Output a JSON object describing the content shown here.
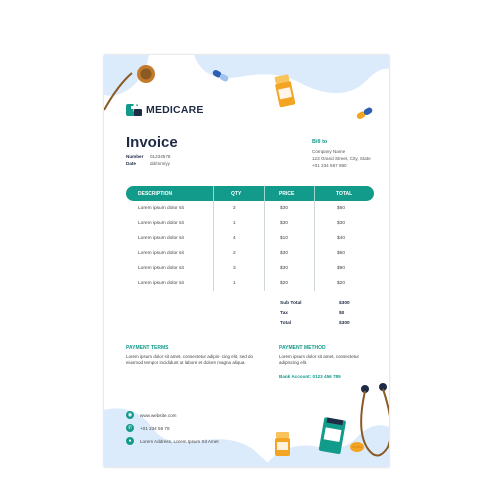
{
  "brand": {
    "name": "MEDICARE"
  },
  "invoice": {
    "title": "Invoice",
    "number_label": "Number",
    "number_value": "01234578",
    "date_label": "Date",
    "date_value": "dd/mm/yy"
  },
  "bill_to": {
    "heading": "Bill to",
    "company": "Company Name",
    "address": "123 Grand Street, City, State",
    "phone": "+01 234 567 890"
  },
  "table": {
    "headers": [
      "DESCRIPTION",
      "QTY",
      "PRICE",
      "TOTAL"
    ],
    "rows": [
      {
        "desc": "Lorem ipsum dolor sit",
        "qty": "2",
        "price": "$30",
        "total": "$60"
      },
      {
        "desc": "Lorem ipsum dolor sit",
        "qty": "1",
        "price": "$30",
        "total": "$30"
      },
      {
        "desc": "Lorem ipsum dolor sit",
        "qty": "4",
        "price": "$10",
        "total": "$40"
      },
      {
        "desc": "Lorem ipsum dolor sit",
        "qty": "2",
        "price": "$30",
        "total": "$60"
      },
      {
        "desc": "Lorem ipsum dolor sit",
        "qty": "3",
        "price": "$30",
        "total": "$90"
      },
      {
        "desc": "Lorem ipsum dolor sit",
        "qty": "1",
        "price": "$20",
        "total": "$20"
      }
    ]
  },
  "totals": {
    "subtotal_label": "Sub Total",
    "subtotal_value": "$300",
    "tax_label": "Tax",
    "tax_value": "$0",
    "total_label": "Total",
    "total_value": "$300"
  },
  "payment_terms": {
    "heading": "PAYMENT TERMS",
    "text": "Lorem ipsum dolor sit amet, consectetur adipis- cing elit, sed do eiusmod tempor incididunt ut labore et dolore magna aliqua."
  },
  "payment_method": {
    "heading": "PAYMENT METHOD",
    "text": "Lorem ipsum dolor sit amet, consectetur adipiscing elit.",
    "bank": "Bank Account: 0123 456 789"
  },
  "contact": {
    "website": "www.website.com",
    "phone": "+01 234 56 78",
    "address": "Lorem Address, Lorem Ipsum Sit Amet"
  },
  "colors": {
    "accent": "#129a8a",
    "blob": "#dcebfb",
    "navy": "#1f2b45",
    "pill_orange": "#f4a423",
    "pill_blue": "#2f5fb3",
    "stethoscope": "#8a5a24"
  },
  "icons": [
    "medical-cross-logo-icon",
    "stethoscope-icon",
    "capsule-icon",
    "pill-bottle-icon",
    "tablet-icon",
    "globe-icon",
    "phone-icon",
    "location-pin-icon"
  ]
}
